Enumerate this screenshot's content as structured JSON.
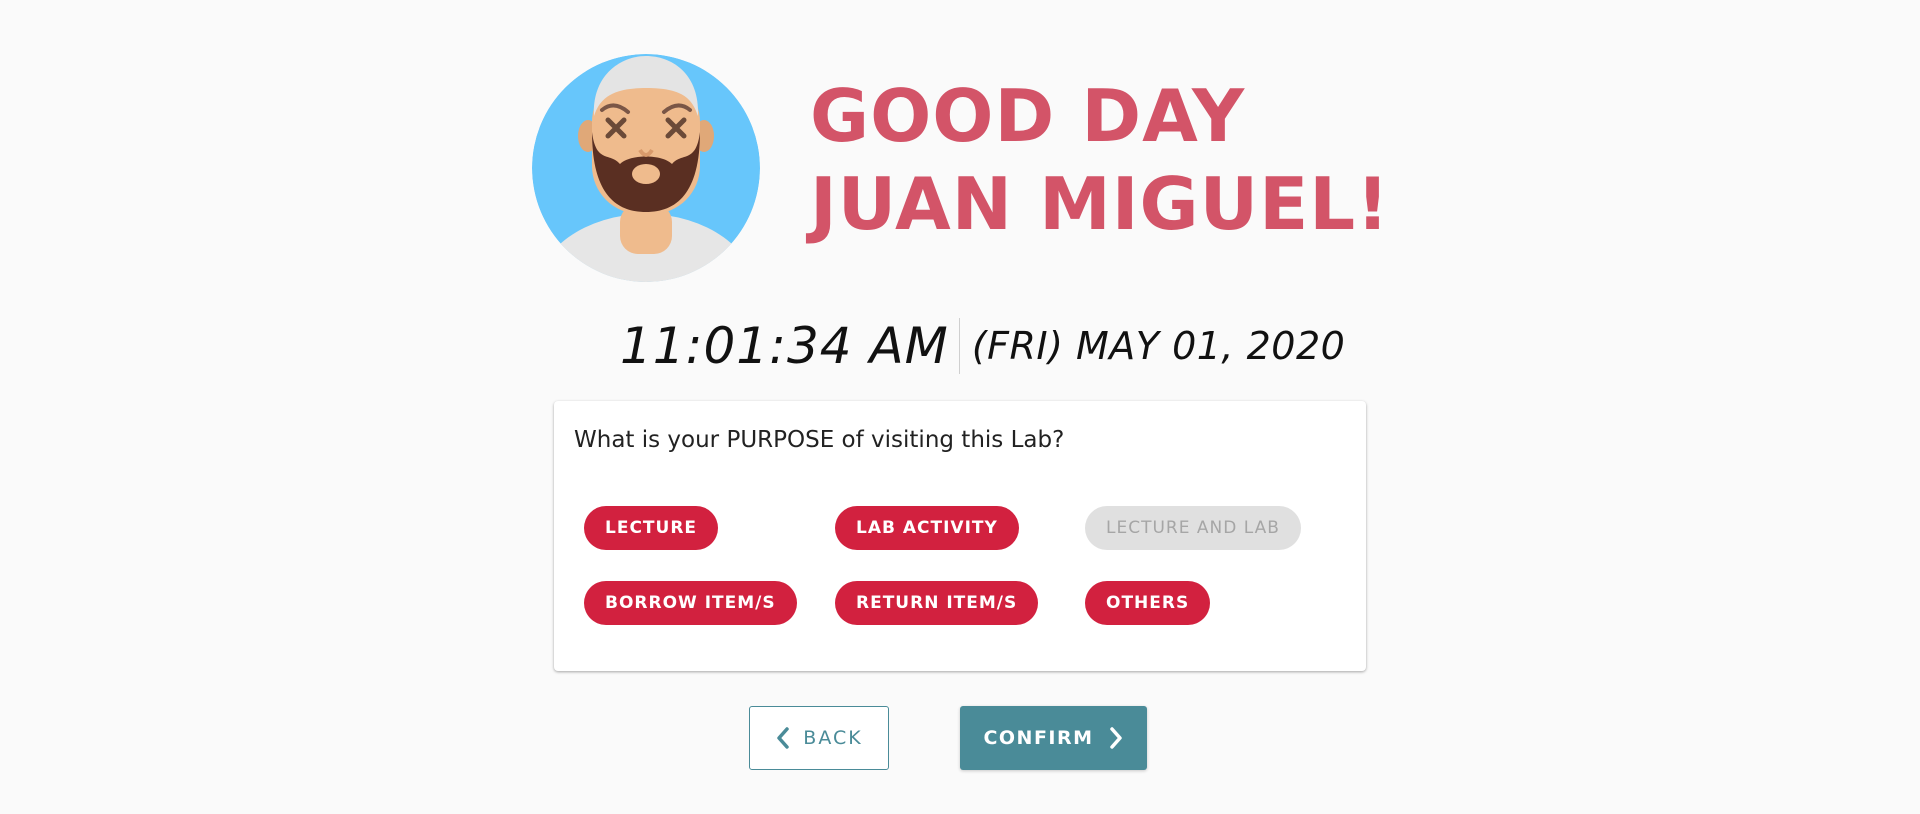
{
  "greeting": {
    "line1": "GOOD DAY",
    "line2": "JUAN MIGUEL!",
    "color": "#d35468"
  },
  "avatar": {
    "icon": "bearded-man-avatar-icon"
  },
  "clock": {
    "time": "11:01:34 AM",
    "date": "(FRI) MAY 01, 2020"
  },
  "purpose": {
    "question": "What is your PURPOSE of visiting this Lab?",
    "options": [
      {
        "label": "LECTURE",
        "enabled": true
      },
      {
        "label": "LAB ACTIVITY",
        "enabled": true
      },
      {
        "label": "LECTURE AND LAB",
        "enabled": false
      },
      {
        "label": "BORROW ITEM/S",
        "enabled": true
      },
      {
        "label": "RETURN ITEM/S",
        "enabled": true
      },
      {
        "label": "OTHERS",
        "enabled": true
      }
    ],
    "chip_color": "#d2213f",
    "disabled_color": "#e0e0e0"
  },
  "actions": {
    "back_label": "BACK",
    "confirm_label": "CONFIRM",
    "accent": "#4a8b98"
  }
}
